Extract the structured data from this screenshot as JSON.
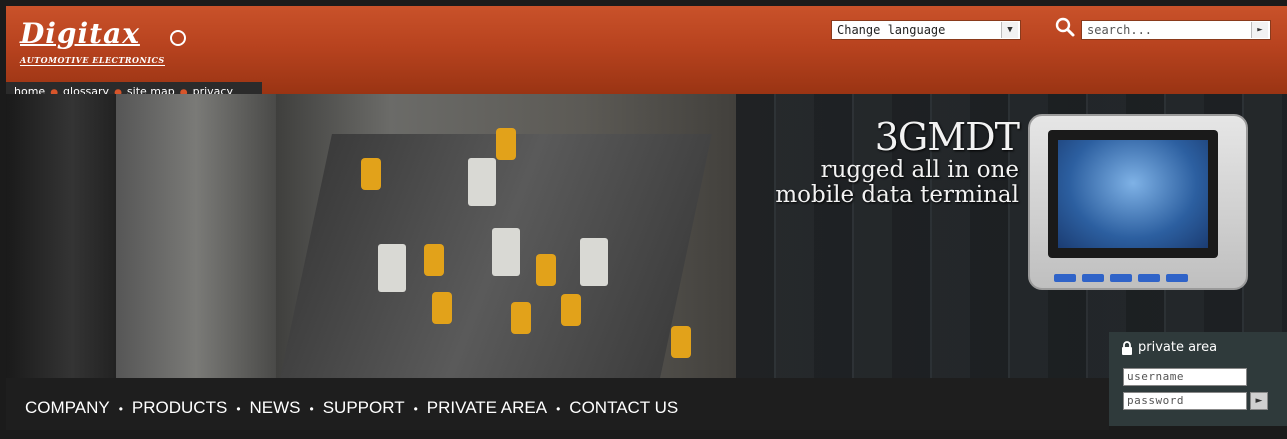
{
  "logo": {
    "word": "Digitax",
    "sub": "AUTOMOTIVE ELECTRONICS"
  },
  "header": {
    "language_select": {
      "value": "Change language"
    },
    "search": {
      "placeholder": "search..."
    }
  },
  "top_links": [
    "home",
    "glossary",
    "site map",
    "privacy"
  ],
  "banner": {
    "title": "3GMDT",
    "line1": "rugged all in one",
    "line2": "mobile data terminal"
  },
  "private_area": {
    "title": "private area",
    "username_placeholder": "username",
    "password_placeholder": "password"
  },
  "main_nav": [
    "COMPANY",
    "PRODUCTS",
    "NEWS",
    "SUPPORT",
    "PRIVATE AREA",
    "CONTACT US"
  ],
  "colors": {
    "header": "#b8431f",
    "accent": "#d7552b",
    "nav_bg": "#1e1e1e",
    "private_bg": "#2f3a3b"
  }
}
